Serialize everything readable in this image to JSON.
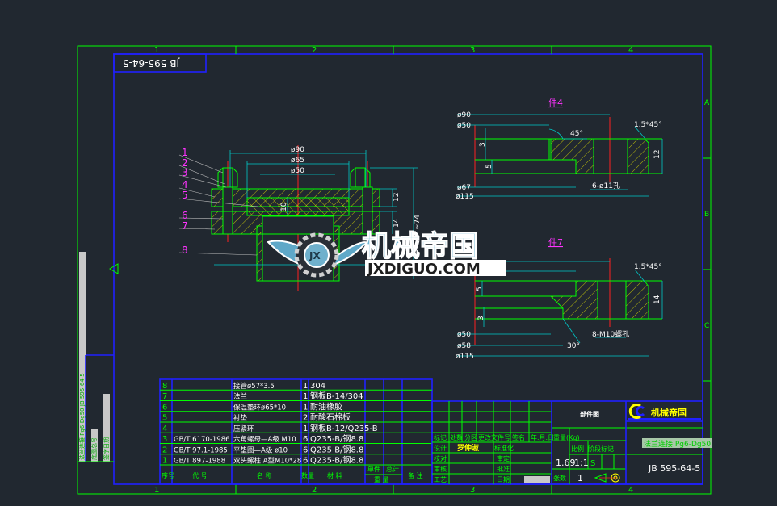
{
  "drawing_number": "JB 595-64-5",
  "zones": {
    "columns": [
      "1",
      "2",
      "3",
      "4"
    ],
    "rows": [
      "A",
      "B",
      "C"
    ]
  },
  "colors": {
    "background": "#212830",
    "outline": "#00ff00",
    "frame": "#2020ff",
    "dimension": "#00c8c8",
    "centerline": "#ff2020",
    "hatch": "#e0e000",
    "balloon": "#ff33ff"
  },
  "main_view": {
    "balloons": [
      "1",
      "2",
      "3",
      "4",
      "5",
      "6",
      "7",
      "8"
    ],
    "dims": {
      "d90": "ø90",
      "d65": "ø65",
      "d50": "ø50",
      "t10": "10",
      "t12": "12",
      "t14": "14",
      "h74": "~74"
    }
  },
  "detail_4": {
    "title": "件4",
    "dims": {
      "d90": "ø90",
      "d50": "ø50",
      "d67": "ø67",
      "d115": "ø115",
      "h3": "3",
      "h5": "5",
      "t12": "12",
      "angle": "45°",
      "chamfer": "1.5*45°",
      "holes": "6-ø11孔"
    }
  },
  "detail_7": {
    "title": "件7",
    "dims": {
      "d50": "ø50",
      "d58": "ø58",
      "d115": "ø115",
      "h5": "5",
      "h3": "3",
      "t14": "14",
      "angle": "30°",
      "chamfer": "1.5*45°",
      "holes": "8-M10螺孔"
    }
  },
  "watermark": {
    "badge": "JX",
    "cn": "机械帝国",
    "url": "JXDIGUO.COM"
  },
  "parts_table": {
    "headers": {
      "no": "序号",
      "code": "代 号",
      "name": "名 称",
      "qty": "数量",
      "material": "材 料",
      "unit": "单件",
      "total": "总计",
      "weight": "重 量",
      "remark": "备 注"
    },
    "rows": [
      {
        "no": "8",
        "code": "",
        "name": "接管ø57*3.5",
        "qty": "1",
        "material": "304"
      },
      {
        "no": "7",
        "code": "",
        "name": "法兰",
        "qty": "1",
        "material": "钢板B-14/304"
      },
      {
        "no": "6",
        "code": "",
        "name": "保温垫环ø65*10",
        "qty": "1",
        "material": "耐油橡胶"
      },
      {
        "no": "5",
        "code": "",
        "name": "衬垫",
        "qty": "2",
        "material": "耐酸石棉板"
      },
      {
        "no": "4",
        "code": "",
        "name": "压紧环",
        "qty": "1",
        "material": "钢板B-12/Q235-B"
      },
      {
        "no": "3",
        "code": "GB/T 6170-1986",
        "name": "六角螺母—A级 M10",
        "qty": "6",
        "material": "Q235-B/钢8.8"
      },
      {
        "no": "2",
        "code": "GB/T 97.1-1985",
        "name": "平垫圈—A级 ø10",
        "qty": "6",
        "material": "Q235-B/钢8.8"
      },
      {
        "no": "1",
        "code": "GB/T 897-1988",
        "name": "双头螺柱 A型M10*28",
        "qty": "6",
        "material": "Q235-B/钢8.8"
      }
    ]
  },
  "title_block": {
    "revision_headers": [
      "标记",
      "处数",
      "分区",
      "更改文件号",
      "签名",
      "年.月.日"
    ],
    "roles_left": [
      "设计",
      "校对",
      "审核",
      "工艺"
    ],
    "designer": "罗仲淑",
    "roles_right": [
      "标准化",
      "审定",
      "批准",
      "日期"
    ],
    "drawing_type": "部件图",
    "stage_label": "阶段标记",
    "weight_label": "重量(Kg)",
    "scale_label": "比例",
    "weight": "1.69",
    "scale": "1:1",
    "stage": "S",
    "sheets_label": "张数",
    "sheets": "1",
    "company": "机械帝国",
    "subtitle": "法兰连接 Pg6-Dg50",
    "number": "JB 595-64-5"
  },
  "side_strip": {
    "text1": "法兰连接 Pg6-Dg50 JB 595-64-5",
    "text2": "底图总号",
    "text3": "签字日期"
  }
}
